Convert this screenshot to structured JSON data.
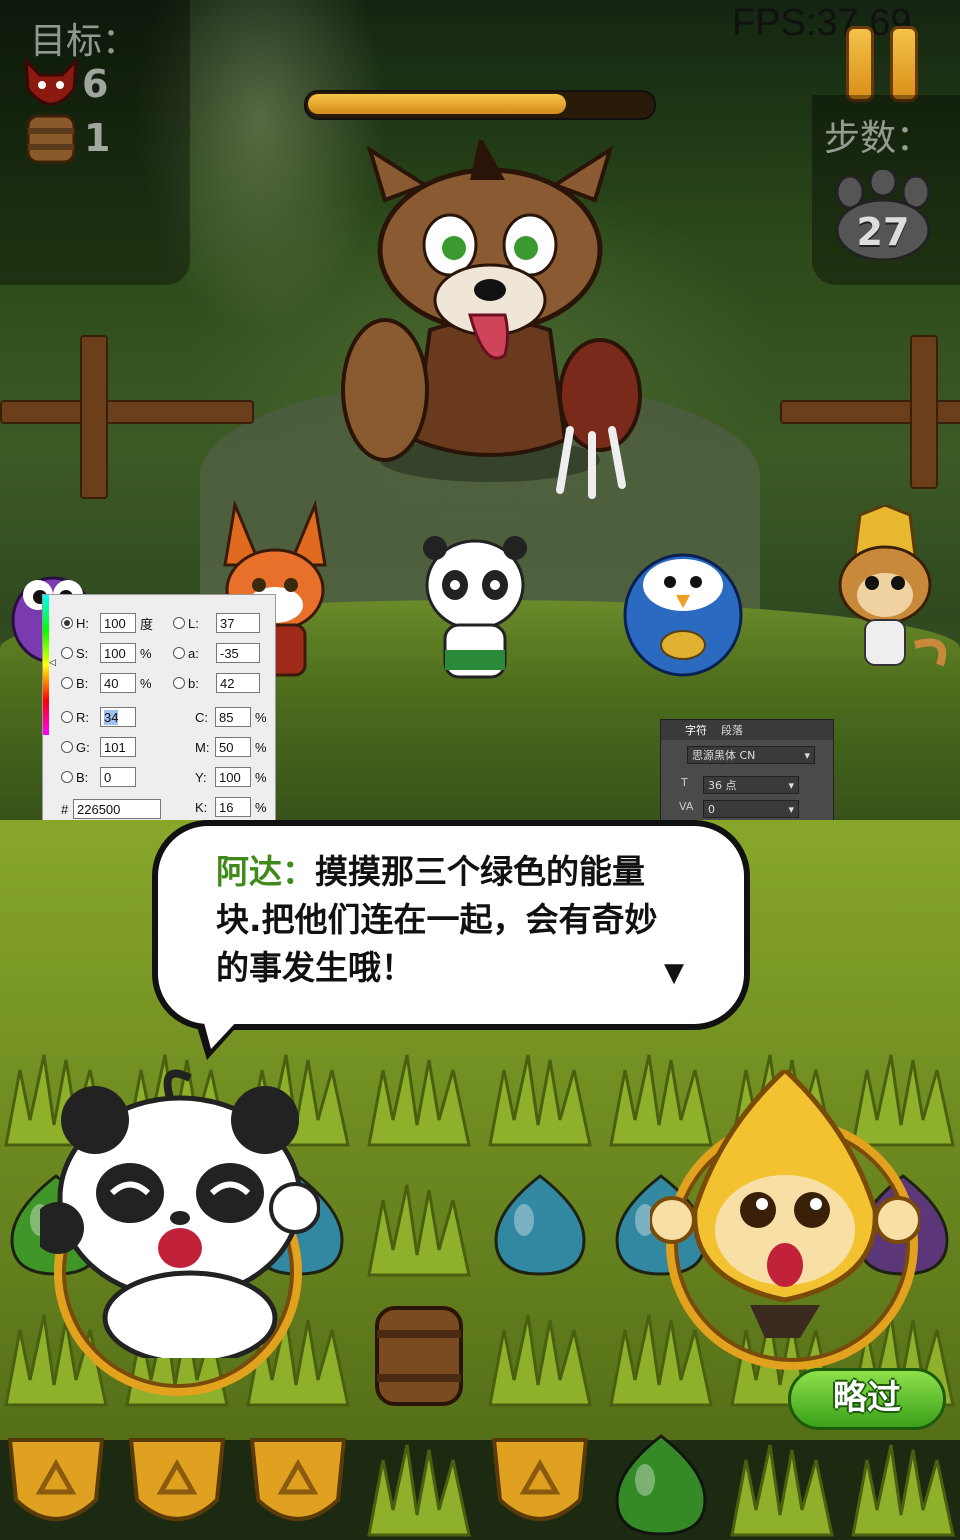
{
  "hud": {
    "goal_label": "目标：",
    "goals": [
      {
        "icon": "red-creature-icon",
        "count": "6"
      },
      {
        "icon": "barrel-icon",
        "count": "1"
      }
    ],
    "moves_label": "步数：",
    "moves_value": "27",
    "fps": "FPS:37.69",
    "boss_health": 0.75
  },
  "color_picker": {
    "H": "100",
    "H_unit": "度",
    "S": "100",
    "S_unit": "%",
    "Bv": "40",
    "B_unit": "%",
    "L": "37",
    "a": "-35",
    "b_lab": "42",
    "R": "34",
    "G": "101",
    "Bc": "0",
    "C": "85",
    "M": "50",
    "Y": "100",
    "K": "16",
    "pct": "%",
    "hex_label": "#",
    "hex": "226500",
    "labels": {
      "H": "H:",
      "S": "S:",
      "B": "B:",
      "L": "L:",
      "a": "a:",
      "b": "b:",
      "R": "R:",
      "G": "G:",
      "B2": "B:",
      "C": "C:",
      "M": "M:",
      "Y": "Y:",
      "K": "K:"
    }
  },
  "char_panel": {
    "tab_char": "字符",
    "tab_para": "段落",
    "font": "思源黑体 CN",
    "size": "36 点",
    "tracking": "0"
  },
  "dialog": {
    "speaker": "阿达：",
    "text_line1": "摸摸那三个绿色的能量",
    "text_line2": "块.把他们连在一起，会有奇妙",
    "text_line3": "的事发生哦！",
    "more_indicator": "▼"
  },
  "skip_button": "略过",
  "colors": {
    "speaker": "#3f8a1a",
    "skip": "#3aa11a",
    "bar_fill": "#f0b83c"
  }
}
